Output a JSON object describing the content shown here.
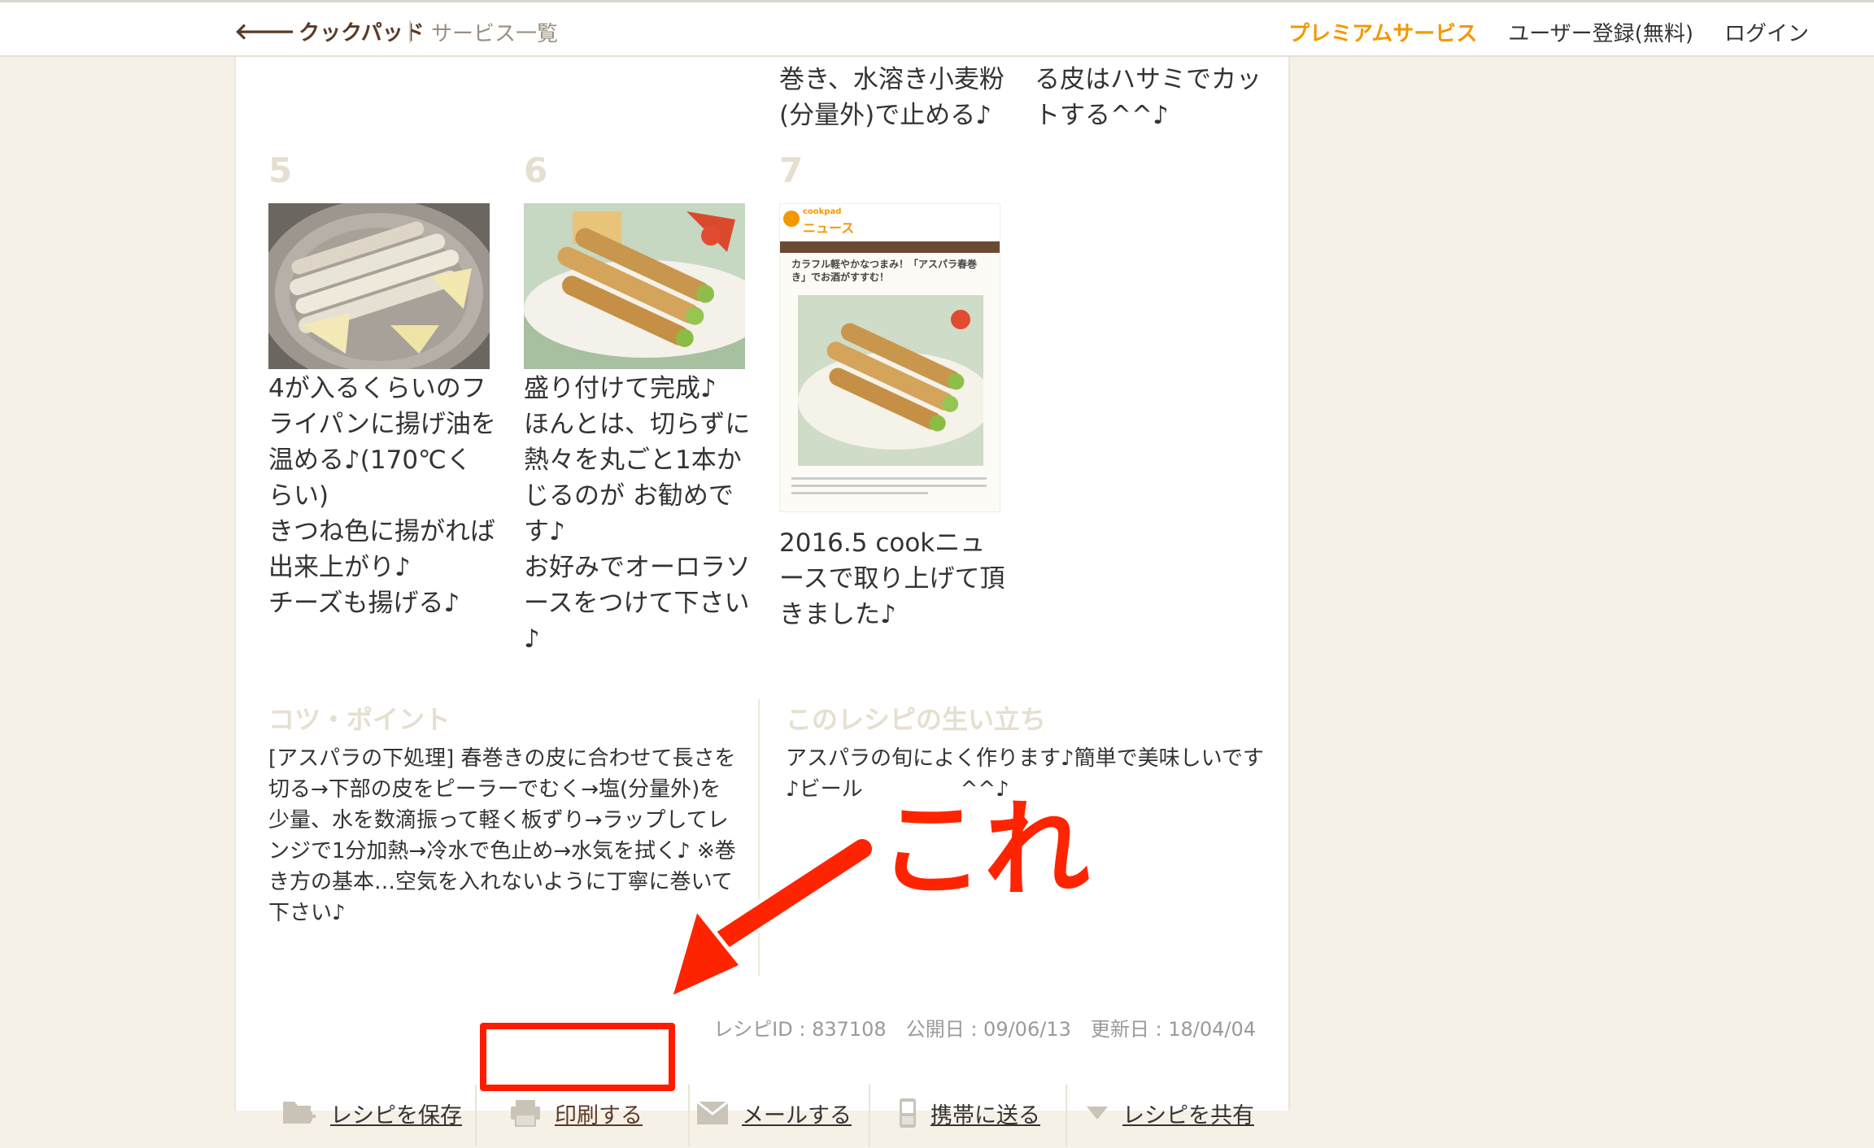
{
  "header": {
    "back_label": "クックパッド",
    "services_label": "サービス一覧",
    "nav": {
      "premium": "プレミアムサービス",
      "register": "ユーザー登録(無料)",
      "login": "ログイン"
    }
  },
  "steps_top": [
    {
      "text": "巻き、水溶き小麦粉\n(分量外)で止める♪"
    },
    {
      "text": "る皮はハサミでカッ\nトする^^♪"
    }
  ],
  "steps": [
    {
      "number": "5",
      "text": "4が入るくらいのフ\nライパンに揚げ油を\n温める♪(170℃く\nらい)\nきつね色に揚がれば\n出来上がり♪\nチーズも揚げる♪"
    },
    {
      "number": "6",
      "text": "盛り付けて完成♪\nほんとは、切らずに\n熱々を丸ごと1本か\nじるのが お勧めで\nす♪\nお好みでオーロラソ\nースをつけて下さい\n♪"
    },
    {
      "number": "7",
      "text": "2016.5 cookニュ\nースで取り上げて頂\nきました♪"
    }
  ],
  "news_screenshot": {
    "brand": "cookpad",
    "title": "ニュース",
    "headline": "カラフル軽やかなつまみ！「アスパラ春巻き」でお酒がすすむ！"
  },
  "tips": {
    "title": "コツ・ポイント",
    "text": "[アスパラの下処理] 春巻きの皮に合わせて長さを切る→下部の皮をピーラーでむく→塩(分量外)を少量、水を数滴振って軽く板ずり→ラップしてレンジで1分加熱→冷水で色止め→水気を拭く♪ ※巻き方の基本…空気を入れないように丁寧に巻いて下さい♪"
  },
  "history": {
    "title": "このレシピの生い立ち",
    "text": "アスパラの旬によく作ります♪簡単で美味しいです♪ビール",
    "text_tail": "^^♪"
  },
  "meta": {
    "recipe_id": "レシピID : 837108",
    "published": "公開日 : 09/06/13",
    "updated": "更新日 : 18/04/04"
  },
  "actions": {
    "save": "レシピを保存",
    "print": "印刷する",
    "mail": "メールする",
    "mobile": "携帯に送る",
    "share": "レシピを共有"
  },
  "annotation": {
    "label": "これ",
    "color": "#ff2400"
  },
  "colors": {
    "brand_brown": "#5b3a26",
    "premium_orange": "#f39800",
    "step_number_beige": "#e6dfd0",
    "background": "#f6f1e6"
  }
}
